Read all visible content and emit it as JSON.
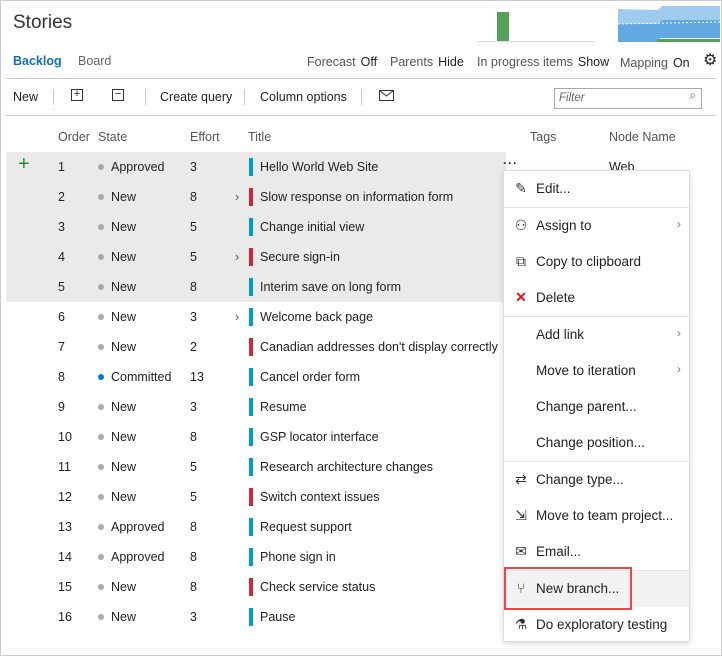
{
  "header": {
    "title": "Stories"
  },
  "tabs": [
    {
      "label": "Backlog",
      "active": true
    },
    {
      "label": "Board",
      "active": false
    }
  ],
  "options": [
    {
      "label": "Forecast",
      "value": "Off"
    },
    {
      "label": "Parents",
      "value": "Hide"
    },
    {
      "label": "In progress items",
      "value": "Show"
    },
    {
      "label": "Mapping",
      "value": "On"
    }
  ],
  "toolbar": {
    "new": "New",
    "expand_icon": "plus-box-icon",
    "collapse_icon": "minus-box-icon",
    "create_query": "Create query",
    "column_options": "Column options",
    "email_icon": "mail-icon",
    "filter_placeholder": "Filter"
  },
  "columns": {
    "order": "Order",
    "state": "State",
    "effort": "Effort",
    "title": "Title",
    "tags": "Tags",
    "node": "Node Name"
  },
  "colors": {
    "story": "#009ccc",
    "bug": "#cc293d",
    "committed": "#007acc",
    "new": "#aaaaaa",
    "accent": "#106ebe",
    "highlight": "#e8483f"
  },
  "rows": [
    {
      "order": "1",
      "state": "Approved",
      "effort": "3",
      "title": "Hello World Web Site",
      "type": "story",
      "node": "Web",
      "sel": true
    },
    {
      "order": "2",
      "state": "New",
      "effort": "8",
      "title": "Slow response on information form",
      "type": "bug",
      "expand": true,
      "sel": true
    },
    {
      "order": "3",
      "state": "New",
      "effort": "5",
      "title": "Change initial view",
      "type": "story",
      "sel": true
    },
    {
      "order": "4",
      "state": "New",
      "effort": "5",
      "title": "Secure sign-in",
      "type": "bug",
      "expand": true,
      "sel": true
    },
    {
      "order": "5",
      "state": "New",
      "effort": "8",
      "title": "Interim save on long form",
      "type": "story",
      "sel": true
    },
    {
      "order": "6",
      "state": "New",
      "effort": "3",
      "title": "Welcome back page",
      "type": "story",
      "expand": true
    },
    {
      "order": "7",
      "state": "New",
      "effort": "2",
      "title": "Canadian addresses don't display correctly",
      "type": "bug"
    },
    {
      "order": "8",
      "state": "Committed",
      "effort": "13",
      "title": "Cancel order form",
      "type": "story"
    },
    {
      "order": "9",
      "state": "New",
      "effort": "3",
      "title": "Resume",
      "type": "story"
    },
    {
      "order": "10",
      "state": "New",
      "effort": "8",
      "title": "GSP locator interface",
      "type": "story"
    },
    {
      "order": "11",
      "state": "New",
      "effort": "5",
      "title": "Research architecture changes",
      "type": "story"
    },
    {
      "order": "12",
      "state": "New",
      "effort": "5",
      "title": "Switch context issues",
      "type": "bug"
    },
    {
      "order": "13",
      "state": "Approved",
      "effort": "8",
      "title": "Request support",
      "type": "story"
    },
    {
      "order": "14",
      "state": "Approved",
      "effort": "8",
      "title": "Phone sign in",
      "type": "story"
    },
    {
      "order": "15",
      "state": "New",
      "effort": "8",
      "title": "Check service status",
      "type": "bug"
    },
    {
      "order": "16",
      "state": "New",
      "effort": "3",
      "title": "Pause",
      "type": "story"
    }
  ],
  "menu": [
    {
      "label": "Edit...",
      "icon": "pencil-icon"
    },
    {
      "label": "Assign to",
      "icon": "people-icon",
      "sub": true
    },
    {
      "label": "Copy to clipboard",
      "icon": "copy-icon"
    },
    {
      "label": "Delete",
      "icon": "delete-x-icon"
    },
    {
      "label": "Add link",
      "sub": true
    },
    {
      "label": "Move to iteration",
      "sub": true
    },
    {
      "label": "Change parent..."
    },
    {
      "label": "Change position..."
    },
    {
      "label": "Change type...",
      "icon": "swap-arrows-icon"
    },
    {
      "label": "Move to team project...",
      "icon": "move-project-icon"
    },
    {
      "label": "Email...",
      "icon": "mail-icon"
    },
    {
      "label": "New branch...",
      "icon": "branch-icon",
      "highlighted": true
    },
    {
      "label": "Do exploratory testing",
      "icon": "flask-icon"
    }
  ]
}
